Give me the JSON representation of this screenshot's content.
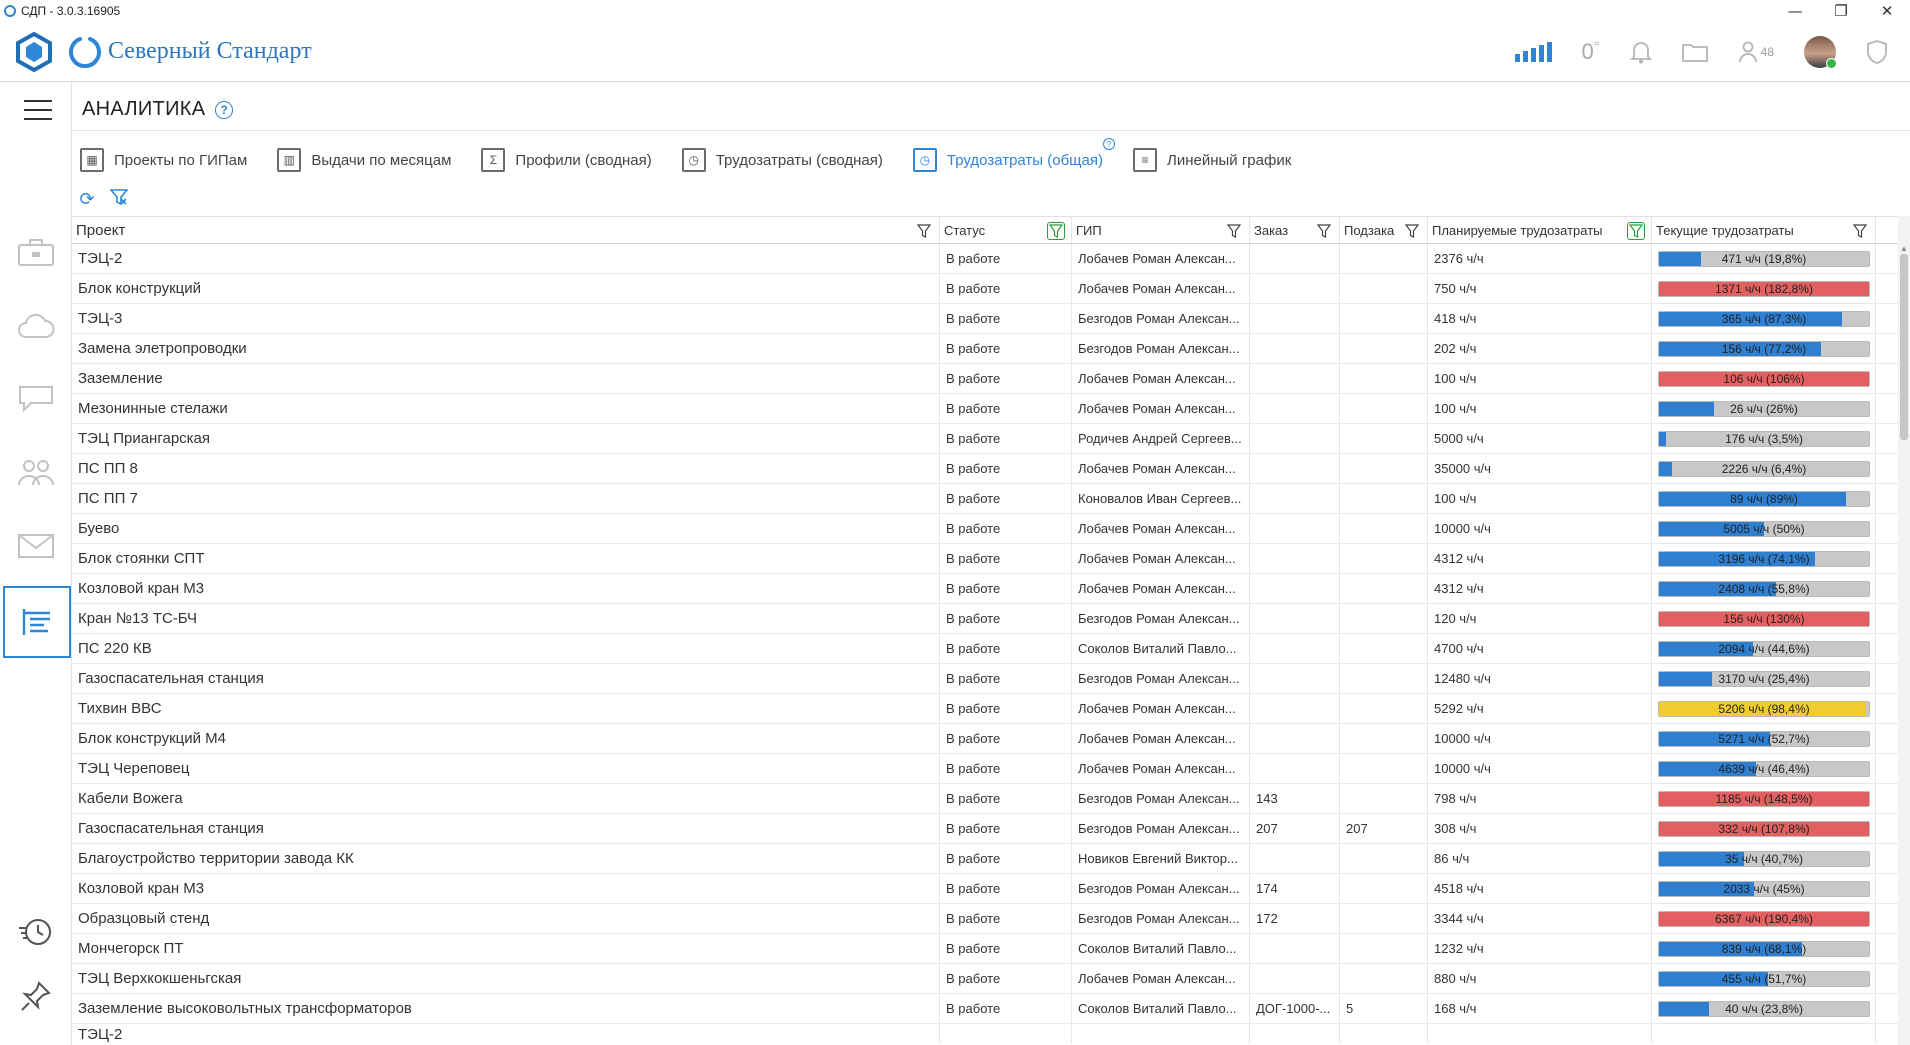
{
  "window": {
    "title": "СДП - 3.0.3.16905",
    "controls": [
      "—",
      "❐",
      "✕"
    ]
  },
  "header": {
    "brand": "Северный Стандарт",
    "notifications_zero": "0",
    "users_count": "48",
    "accent": "#2f86d6"
  },
  "rail": {
    "icons": [
      "menu-icon",
      "briefcase-icon",
      "cloud-icon",
      "chat-icon",
      "team-icon",
      "mail-icon",
      "analytics-icon",
      "history-icon",
      "pin-icon"
    ]
  },
  "page": {
    "title": "АНАЛИТИКА",
    "help": "?"
  },
  "tabs": [
    {
      "label": "Проекты по ГИПам",
      "glyph": "▦",
      "active": false
    },
    {
      "label": "Выдачи по месяцам",
      "glyph": "▥",
      "active": false
    },
    {
      "label": "Профили (сводная)",
      "glyph": "Σ",
      "active": false
    },
    {
      "label": "Трудозатраты (сводная)",
      "glyph": "◷",
      "active": false
    },
    {
      "label": "Трудозатраты (общая)",
      "glyph": "◷",
      "active": true
    },
    {
      "label": "Линейный график",
      "glyph": "≡",
      "active": false
    }
  ],
  "columns": {
    "project": "Проект",
    "status": "Статус",
    "gip": "ГИП",
    "order": "Заказ",
    "suborder": "Подзака",
    "planned": "Планируемые трудозатраты",
    "current": "Текущие трудозатраты"
  },
  "rows": [
    {
      "project": "ТЭЦ-2",
      "status": "В работе",
      "gip": "Лобачев Роман Алексан...",
      "order": "",
      "suborder": "",
      "planned": "2376 ч/ч",
      "current": "471 ч/ч (19,8%)",
      "fraction": 0.198,
      "color": "blue"
    },
    {
      "project": "Блок конструкций",
      "status": "В работе",
      "gip": "Лобачев Роман Алексан...",
      "order": "",
      "suborder": "",
      "planned": "750 ч/ч",
      "current": "1371 ч/ч (182,8%)",
      "fraction": 1.0,
      "color": "red"
    },
    {
      "project": "ТЭЦ-3",
      "status": "В работе",
      "gip": "Безгодов Роман Алексан...",
      "order": "",
      "suborder": "",
      "planned": "418 ч/ч",
      "current": "365 ч/ч (87,3%)",
      "fraction": 0.873,
      "color": "blue"
    },
    {
      "project": "Замена элетропроводки",
      "status": "В работе",
      "gip": "Безгодов Роман Алексан...",
      "order": "",
      "suborder": "",
      "planned": "202 ч/ч",
      "current": "156 ч/ч (77,2%)",
      "fraction": 0.772,
      "color": "blue"
    },
    {
      "project": "Заземление",
      "status": "В работе",
      "gip": "Лобачев Роман Алексан...",
      "order": "",
      "suborder": "",
      "planned": "100 ч/ч",
      "current": "106 ч/ч (106%)",
      "fraction": 1.0,
      "color": "red"
    },
    {
      "project": "Мезонинные стелажи",
      "status": "В работе",
      "gip": "Лобачев Роман Алексан...",
      "order": "",
      "suborder": "",
      "planned": "100 ч/ч",
      "current": "26 ч/ч (26%)",
      "fraction": 0.26,
      "color": "blue"
    },
    {
      "project": "ТЭЦ Приангарская",
      "status": "В работе",
      "gip": "Родичев Андрей Сергеев...",
      "order": "",
      "suborder": "",
      "planned": "5000 ч/ч",
      "current": "176 ч/ч (3,5%)",
      "fraction": 0.035,
      "color": "blue"
    },
    {
      "project": "ПС ПП 8",
      "status": "В работе",
      "gip": "Лобачев Роман Алексан...",
      "order": "",
      "suborder": "",
      "planned": "35000 ч/ч",
      "current": "2226 ч/ч (6,4%)",
      "fraction": 0.064,
      "color": "blue"
    },
    {
      "project": "ПС ПП 7",
      "status": "В работе",
      "gip": "Коновалов Иван Сергеев...",
      "order": "",
      "suborder": "",
      "planned": "100 ч/ч",
      "current": "89 ч/ч (89%)",
      "fraction": 0.89,
      "color": "blue"
    },
    {
      "project": "Буево",
      "status": "В работе",
      "gip": "Лобачев Роман Алексан...",
      "order": "",
      "suborder": "",
      "planned": "10000 ч/ч",
      "current": "5005 ч/ч (50%)",
      "fraction": 0.5,
      "color": "blue"
    },
    {
      "project": "Блок стоянки СПТ",
      "status": "В работе",
      "gip": "Лобачев Роман Алексан...",
      "order": "",
      "suborder": "",
      "planned": "4312 ч/ч",
      "current": "3196 ч/ч (74,1%)",
      "fraction": 0.741,
      "color": "blue"
    },
    {
      "project": "Козловой кран М3",
      "status": "В работе",
      "gip": "Лобачев Роман Алексан...",
      "order": "",
      "suborder": "",
      "planned": "4312 ч/ч",
      "current": "2408 ч/ч (55,8%)",
      "fraction": 0.558,
      "color": "blue"
    },
    {
      "project": "Кран №13 ТС-БЧ",
      "status": "В работе",
      "gip": "Безгодов Роман Алексан...",
      "order": "",
      "suborder": "",
      "planned": "120 ч/ч",
      "current": "156 ч/ч (130%)",
      "fraction": 1.0,
      "color": "red"
    },
    {
      "project": "ПС 220 КВ",
      "status": "В работе",
      "gip": "Соколов  Виталий Павло...",
      "order": "",
      "suborder": "",
      "planned": "4700 ч/ч",
      "current": "2094 ч/ч (44,6%)",
      "fraction": 0.446,
      "color": "blue"
    },
    {
      "project": "Газоспасательная станция",
      "status": "В работе",
      "gip": "Безгодов Роман Алексан...",
      "order": "",
      "suborder": "",
      "planned": "12480 ч/ч",
      "current": "3170 ч/ч (25,4%)",
      "fraction": 0.254,
      "color": "blue"
    },
    {
      "project": "Тихвин ВВС",
      "status": "В работе",
      "gip": "Лобачев Роман Алексан...",
      "order": "",
      "suborder": "",
      "planned": "5292 ч/ч",
      "current": "5206 ч/ч (98,4%)",
      "fraction": 0.984,
      "color": "yellow"
    },
    {
      "project": "Блок конструкций М4",
      "status": "В работе",
      "gip": "Лобачев Роман Алексан...",
      "order": "",
      "suborder": "",
      "planned": "10000 ч/ч",
      "current": "5271 ч/ч (52,7%)",
      "fraction": 0.527,
      "color": "blue"
    },
    {
      "project": "ТЭЦ Череповец",
      "status": "В работе",
      "gip": "Лобачев Роман Алексан...",
      "order": "",
      "suborder": "",
      "planned": "10000 ч/ч",
      "current": "4639 ч/ч (46,4%)",
      "fraction": 0.464,
      "color": "blue"
    },
    {
      "project": "Кабели Вожега",
      "status": "В работе",
      "gip": "Безгодов Роман Алексан...",
      "order": "143",
      "suborder": "",
      "planned": "798 ч/ч",
      "current": "1185 ч/ч (148,5%)",
      "fraction": 1.0,
      "color": "red"
    },
    {
      "project": "Газоспасательная станция",
      "status": "В работе",
      "gip": "Безгодов Роман Алексан...",
      "order": "207",
      "suborder": "207",
      "planned": "308 ч/ч",
      "current": "332 ч/ч (107,8%)",
      "fraction": 1.0,
      "color": "red"
    },
    {
      "project": "Благоустройство территории завода КК",
      "status": "В работе",
      "gip": "Новиков Евгений Виктор...",
      "order": "",
      "suborder": "",
      "planned": "86 ч/ч",
      "current": "35 ч/ч (40,7%)",
      "fraction": 0.407,
      "color": "blue"
    },
    {
      "project": "Козловой кран М3",
      "status": "В работе",
      "gip": "Безгодов Роман Алексан...",
      "order": "174",
      "suborder": "",
      "planned": "4518 ч/ч",
      "current": "2033 ч/ч (45%)",
      "fraction": 0.45,
      "color": "blue"
    },
    {
      "project": "Образцовый стенд",
      "status": "В работе",
      "gip": "Безгодов Роман Алексан...",
      "order": "172",
      "suborder": "",
      "planned": "3344 ч/ч",
      "current": "6367 ч/ч (190,4%)",
      "fraction": 1.0,
      "color": "red"
    },
    {
      "project": "Мончегорск ПТ",
      "status": "В работе",
      "gip": "Соколов  Виталий Павло...",
      "order": "",
      "suborder": "",
      "planned": "1232 ч/ч",
      "current": "839 ч/ч (68,1%)",
      "fraction": 0.681,
      "color": "blue"
    },
    {
      "project": "ТЭЦ Верхкокшеньгская",
      "status": "В работе",
      "gip": "Лобачев Роман Алексан...",
      "order": "",
      "suborder": "",
      "planned": "880 ч/ч",
      "current": "455 ч/ч (51,7%)",
      "fraction": 0.517,
      "color": "blue"
    },
    {
      "project": "Заземление высоковольтных трансформаторов",
      "status": "В работе",
      "gip": "Соколов  Виталий Павло...",
      "order": "ДОГ-1000-...",
      "suborder": "5",
      "planned": "168 ч/ч",
      "current": "40 ч/ч (23,8%)",
      "fraction": 0.238,
      "color": "blue"
    },
    {
      "project": "ТЭЦ-2",
      "status": "",
      "gip": "",
      "order": "",
      "suborder": "",
      "planned": "",
      "current": "",
      "fraction": 0,
      "color": "none",
      "partial": true
    }
  ],
  "bar_colors": {
    "blue": "#2f7fd0",
    "red": "#e26060",
    "yellow": "#f0cc30",
    "track": "#c8c8c8"
  }
}
